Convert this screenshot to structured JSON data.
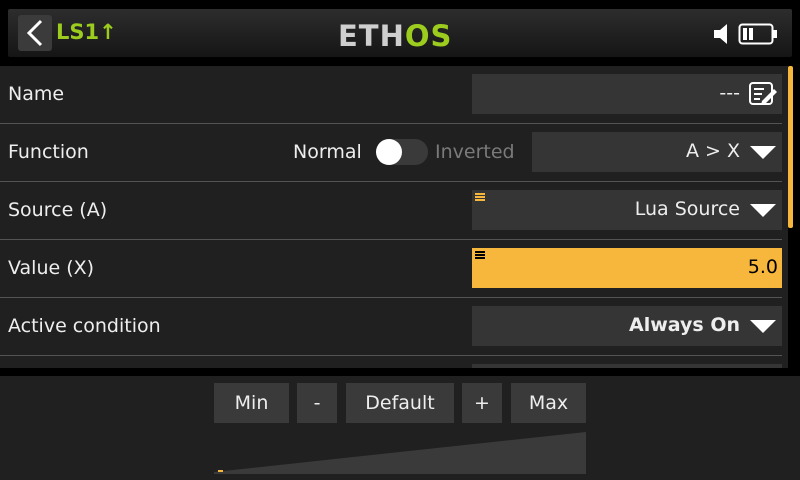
{
  "header": {
    "title": "LS1↑",
    "logo_main": "ETH",
    "logo_accent": "OS"
  },
  "form": {
    "name": {
      "label": "Name",
      "value": "---"
    },
    "function": {
      "label": "Function",
      "toggle_off_label": "Normal",
      "toggle_on_label": "Inverted",
      "value": "A > X"
    },
    "source": {
      "label": "Source (A)",
      "value": "Lua Source"
    },
    "value_x": {
      "label": "Value (X)",
      "value": "5.0"
    },
    "active_condition": {
      "label": "Active condition",
      "value": "Always On"
    }
  },
  "editor": {
    "min_label": "Min",
    "minus_label": "-",
    "default_label": "Default",
    "plus_label": "+",
    "max_label": "Max"
  },
  "colors": {
    "accent_green": "#9ccc1e",
    "highlight_orange": "#f6b73c"
  }
}
